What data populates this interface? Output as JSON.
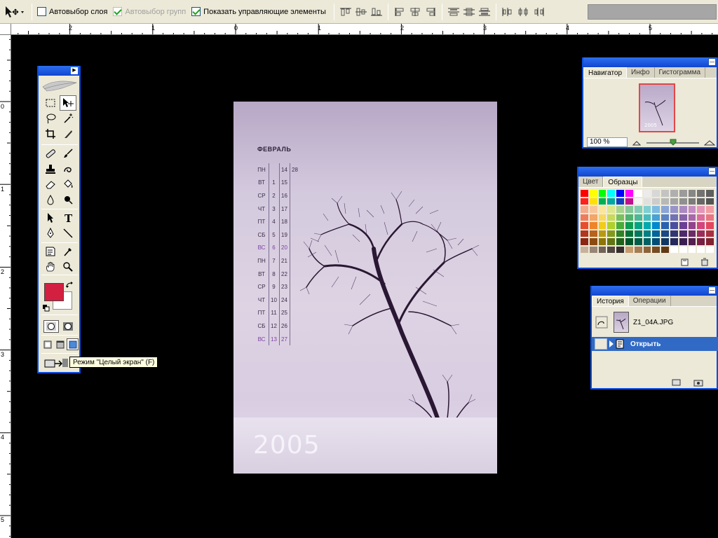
{
  "optionsbar": {
    "auto_select_layer": "Автовыбор слоя",
    "auto_select_group": "Автовыбор групп",
    "show_controls": "Показать управляющие элементы"
  },
  "rulers": {
    "top": [
      "2",
      "1",
      "0",
      "1",
      "2",
      "3",
      "4",
      "5"
    ],
    "left": [
      "0",
      "1",
      "2",
      "3",
      "4",
      "5"
    ]
  },
  "toolbox": {
    "tooltip": "Режим \"Целый экран\" (F)",
    "foreground_color": "#d42040",
    "background_color": "#ffffff"
  },
  "document": {
    "month": "ФЕВРАЛЬ",
    "calendar": [
      {
        "d": "ПН",
        "n": "",
        "m": "14",
        "x": "28",
        "sun": false
      },
      {
        "d": "ВТ",
        "n": "1",
        "m": "15",
        "x": "",
        "sun": false
      },
      {
        "d": "СР",
        "n": "2",
        "m": "16",
        "x": "",
        "sun": false
      },
      {
        "d": "ЧТ",
        "n": "3",
        "m": "17",
        "x": "",
        "sun": false
      },
      {
        "d": "ПТ",
        "n": "4",
        "m": "18",
        "x": "",
        "sun": false
      },
      {
        "d": "СБ",
        "n": "5",
        "m": "19",
        "x": "",
        "sun": false
      },
      {
        "d": "ВС",
        "n": "6",
        "m": "20",
        "x": "",
        "sun": true
      },
      {
        "d": "ПН",
        "n": "7",
        "m": "21",
        "x": "",
        "sun": false
      },
      {
        "d": "ВТ",
        "n": "8",
        "m": "22",
        "x": "",
        "sun": false
      },
      {
        "d": "СР",
        "n": "9",
        "m": "23",
        "x": "",
        "sun": false
      },
      {
        "d": "ЧТ",
        "n": "10",
        "m": "24",
        "x": "",
        "sun": false
      },
      {
        "d": "ПТ",
        "n": "11",
        "m": "25",
        "x": "",
        "sun": false
      },
      {
        "d": "СБ",
        "n": "12",
        "m": "26",
        "x": "",
        "sun": false
      },
      {
        "d": "ВС",
        "n": "13",
        "m": "27",
        "x": "",
        "sun": true
      }
    ],
    "year": "2005"
  },
  "navigator": {
    "tabs": [
      "Навигатор",
      "Инфо",
      "Гистограмма"
    ],
    "zoom": "100 %"
  },
  "swatches": {
    "tabs": [
      "Цвет",
      "Образцы"
    ],
    "colors": [
      "#ff0000",
      "#ffff00",
      "#00ff00",
      "#00ffff",
      "#0000ff",
      "#ff00ff",
      "#ffffff",
      "#ebebeb",
      "#d7d7d7",
      "#c3c3c3",
      "#afafaf",
      "#9b9b9b",
      "#878787",
      "#737373",
      "#5f5f5f",
      "#ff1f1f",
      "#ffe000",
      "#00b050",
      "#00a8a0",
      "#1040c0",
      "#c01090",
      "#f5f5f5",
      "#e0e0e0",
      "#cccccc",
      "#b8b8b8",
      "#a4a4a4",
      "#909090",
      "#7c7c7c",
      "#686868",
      "#545454",
      "#f4a98a",
      "#f8c59a",
      "#fbe59b",
      "#dde68a",
      "#a6d48e",
      "#84c89a",
      "#80cdb5",
      "#7ecfd2",
      "#7dbbe3",
      "#8aa5d6",
      "#9894cb",
      "#a98ac1",
      "#c58cc4",
      "#e894b9",
      "#f29ca4",
      "#ef7b5c",
      "#f5a565",
      "#f8d860",
      "#c8da5b",
      "#79c15e",
      "#4fb372",
      "#4cb799",
      "#46bcbf",
      "#47a2d8",
      "#5c83c6",
      "#7172b8",
      "#8663ac",
      "#a967ae",
      "#dd6c9f",
      "#ea7583",
      "#e84d2e",
      "#f0842b",
      "#f3cc19",
      "#afd129",
      "#48ad38",
      "#0a9d50",
      "#00a482",
      "#00aab0",
      "#0089cf",
      "#2a62b0",
      "#4b4da0",
      "#6b3f93",
      "#94418f",
      "#d3437d",
      "#e3465f",
      "#b3361e",
      "#b8621c",
      "#b89a0f",
      "#82991d",
      "#2e8228",
      "#007238",
      "#007a5e",
      "#007f84",
      "#00669b",
      "#1a4984",
      "#323676",
      "#4c2a6c",
      "#6c2c69",
      "#9c2d5b",
      "#a93043",
      "#8a2612",
      "#8d4a10",
      "#8d7506",
      "#637512",
      "#1f631a",
      "#005629",
      "#005d47",
      "#006165",
      "#004e77",
      "#103865",
      "#25285a",
      "#3a1e52",
      "#531e50",
      "#781f44",
      "#822231",
      "#c7b299",
      "#998675",
      "#736357",
      "#534741",
      "#362f2d",
      "#c69c6d",
      "#a67c52",
      "#8c6239",
      "#754c24",
      "#603913",
      "#ffffff",
      "#ffffff",
      "#ffffff",
      "#ffffff",
      "#ffffff"
    ]
  },
  "history": {
    "tabs": [
      "История",
      "Операции"
    ],
    "snapshot": "Z1_04A.JPG",
    "step": "Открыть"
  },
  "colors": {
    "accent": "#0a4ddd",
    "selection": "#316ac5"
  }
}
